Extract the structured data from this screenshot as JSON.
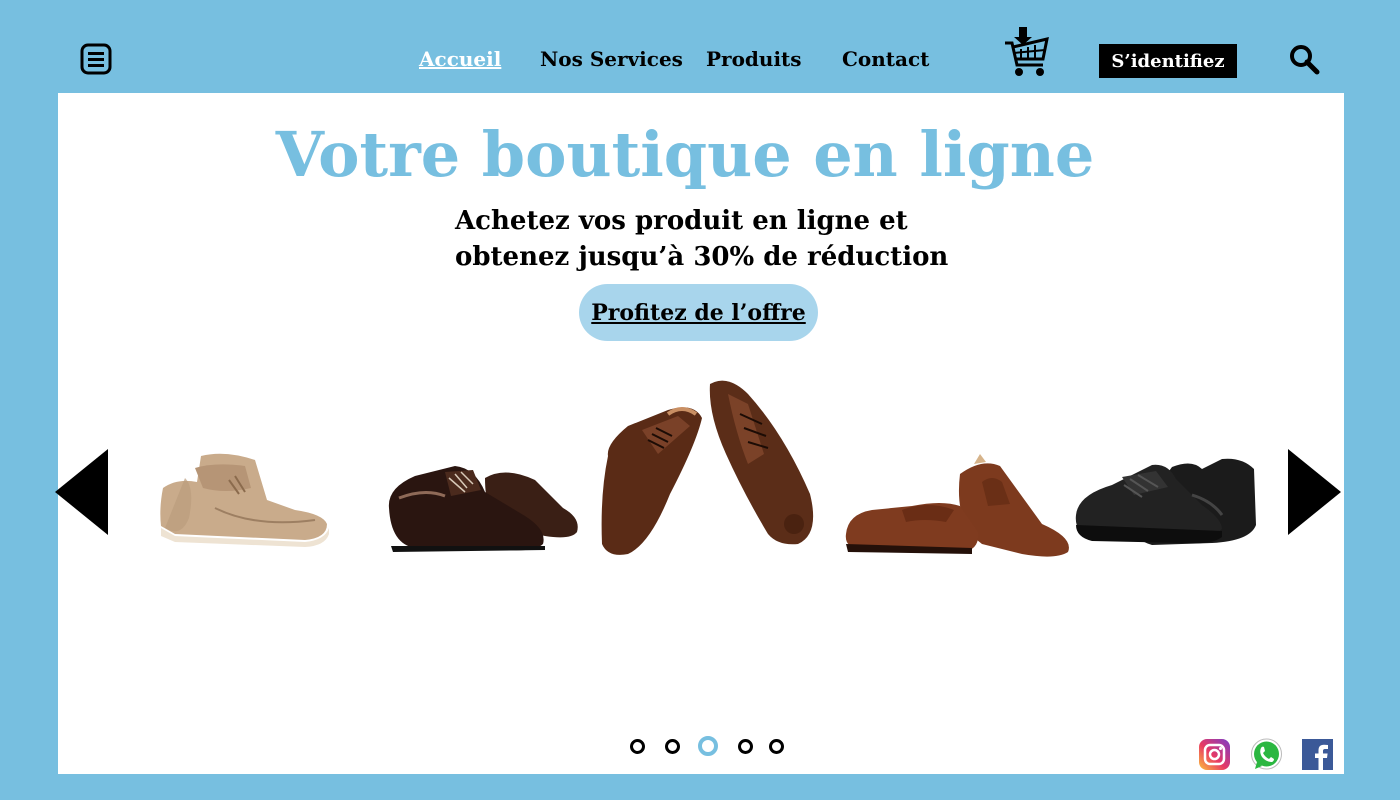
{
  "header": {
    "nav": [
      {
        "label": "Accueil",
        "active": true
      },
      {
        "label": "Nos Services",
        "active": false
      },
      {
        "label": "Produits",
        "active": false
      },
      {
        "label": "Contact",
        "active": false
      }
    ],
    "login_label": "S’identifiez",
    "icons": [
      "menu-icon",
      "cart-icon",
      "search-icon"
    ]
  },
  "hero": {
    "title": "Votre boutique en ligne",
    "subtitle_line1": "Achetez vos produit en ligne et",
    "subtitle_line2": "obtenez jusqu’à 30% de réduction",
    "cta_label": "Profitez de l’offre"
  },
  "carousel": {
    "products": [
      "suede-chukka-boot",
      "black-oxford-shoe",
      "brown-brogue-shoe",
      "brown-penny-loafer",
      "black-sneaker"
    ],
    "dots": 5,
    "active_dot": 3
  },
  "social": [
    "instagram-icon",
    "whatsapp-icon",
    "facebook-icon"
  ],
  "colors": {
    "background": "#77bfe0",
    "accent": "#77bfe0",
    "cta_bg": "#a8d5ec",
    "panel": "#ffffff"
  }
}
